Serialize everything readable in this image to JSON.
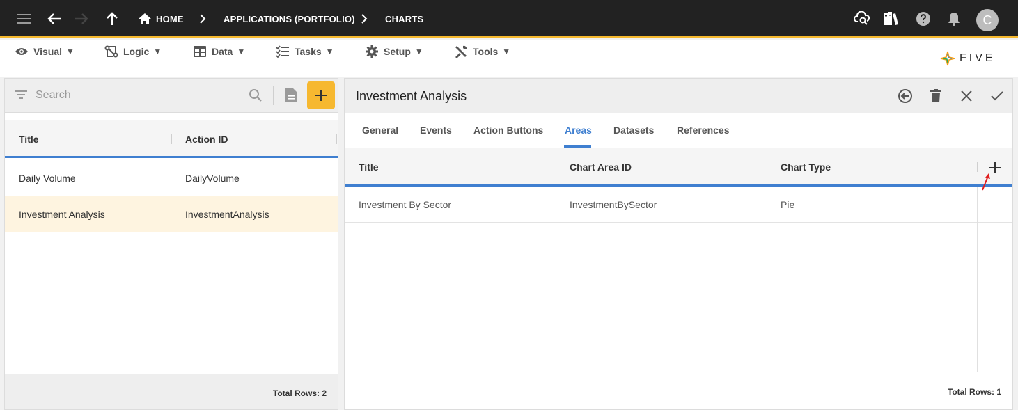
{
  "topbar": {
    "breadcrumbs": [
      "HOME",
      "APPLICATIONS (PORTFOLIO)",
      "CHARTS"
    ],
    "avatar_letter": "C",
    "icons": [
      "menu-icon",
      "back-arrow-icon",
      "forward-arrow-icon",
      "up-arrow-icon",
      "home-icon",
      "chevron-right-icon",
      "cloud-search-icon",
      "library-icon",
      "help-icon",
      "bell-icon"
    ]
  },
  "menubar": {
    "items": [
      {
        "label": "Visual",
        "icon": "eye-icon"
      },
      {
        "label": "Logic",
        "icon": "logic-icon"
      },
      {
        "label": "Data",
        "icon": "table-icon"
      },
      {
        "label": "Tasks",
        "icon": "checklist-icon"
      },
      {
        "label": "Setup",
        "icon": "gear-icon"
      },
      {
        "label": "Tools",
        "icon": "tools-icon"
      }
    ],
    "caret": "▼",
    "logo_text": "FIVE"
  },
  "left_panel": {
    "search_placeholder": "Search",
    "columns": [
      "Title",
      "Action ID"
    ],
    "rows": [
      {
        "title": "Daily Volume",
        "action_id": "DailyVolume",
        "selected": false
      },
      {
        "title": "Investment Analysis",
        "action_id": "InvestmentAnalysis",
        "selected": true
      }
    ],
    "total_rows": "Total Rows: 2"
  },
  "right_panel": {
    "title": "Investment Analysis",
    "tabs": [
      "General",
      "Events",
      "Action Buttons",
      "Areas",
      "Datasets",
      "References"
    ],
    "active_tab": "Areas",
    "columns": [
      "Title",
      "Chart Area ID",
      "Chart Type"
    ],
    "rows": [
      {
        "title": "Investment By Sector",
        "chart_area_id": "InvestmentBySector",
        "chart_type": "Pie"
      }
    ],
    "total_rows": "Total Rows: 1"
  },
  "colors": {
    "topbar_bg": "#222222",
    "accent_orange": "#f6b830",
    "accent_blue": "#3f7fd0",
    "selected_row": "#fef4e0",
    "annotation_arrow": "#e02020"
  }
}
